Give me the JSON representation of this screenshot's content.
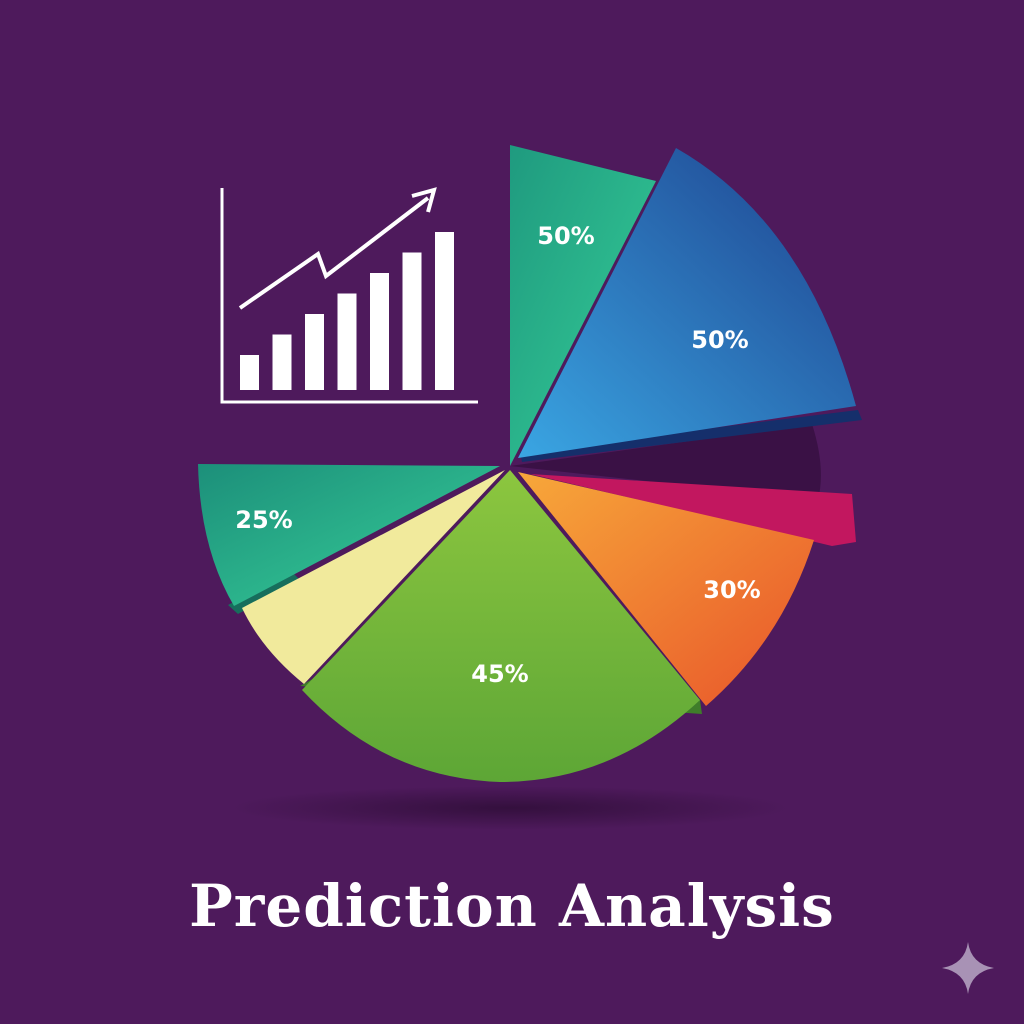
{
  "title": "Prediction Analysis",
  "chart_data": [
    {
      "type": "pie",
      "slices": [
        {
          "label": "50%",
          "value": 50,
          "color": "#2bb58c"
        },
        {
          "label": "50%",
          "value": 50,
          "color": "#2c6fb8"
        },
        {
          "label": "",
          "value": null,
          "color": "#c2175f"
        },
        {
          "label": "30%",
          "value": 30,
          "color": "#ee7b2c"
        },
        {
          "label": "45%",
          "value": 45,
          "color": "#7ab83a"
        },
        {
          "label": "",
          "value": null,
          "color": "#f1ea9c"
        },
        {
          "label": "25%",
          "value": 25,
          "color": "#25a98a"
        }
      ],
      "background": "#4e1a5c"
    },
    {
      "type": "bar",
      "values": [
        2,
        3,
        4,
        5,
        6,
        7,
        8
      ],
      "trend": "rising",
      "color": "#ffffff"
    }
  ],
  "icons": {
    "growth_chart": "growth-chart-icon",
    "sparkle": "sparkle-icon"
  }
}
